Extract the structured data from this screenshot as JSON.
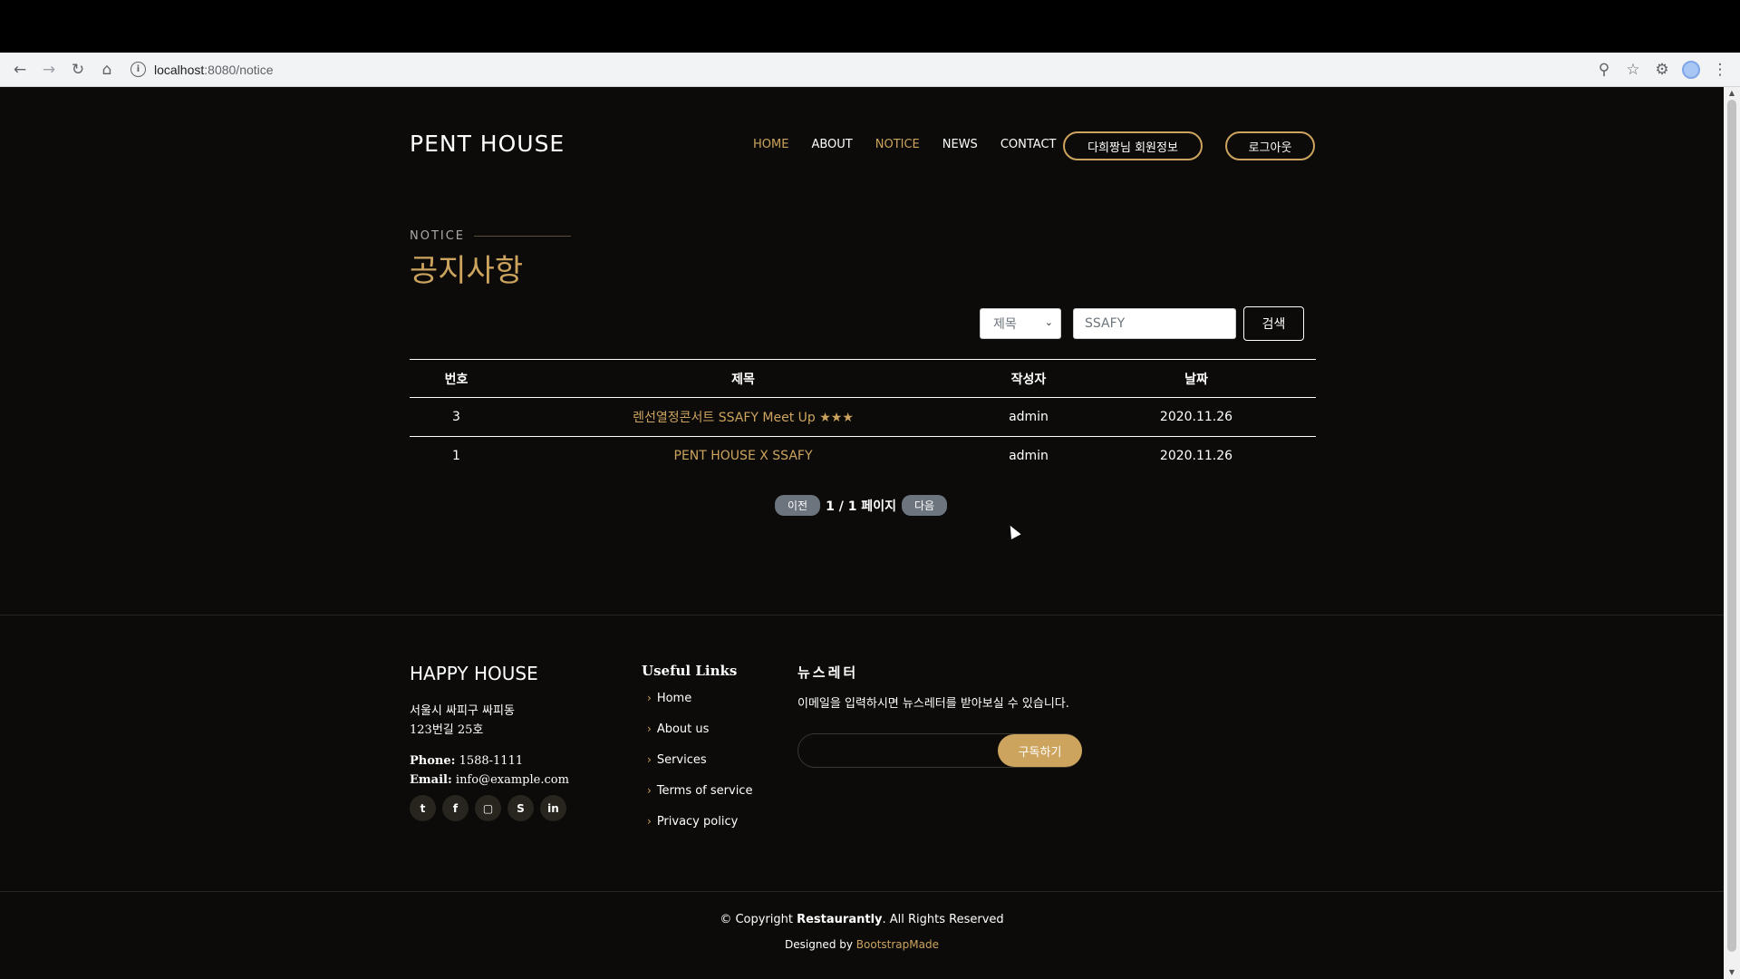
{
  "browser": {
    "url_host": "localhost",
    "url_path": ":8080/notice"
  },
  "header": {
    "logo": "PENT HOUSE",
    "nav": [
      "HOME",
      "ABOUT",
      "NOTICE",
      "NEWS",
      "CONTACT"
    ],
    "active_nav": "NOTICE",
    "member_info_button": "다희짱님 회원정보",
    "logout_button": "로그아웃"
  },
  "section": {
    "label": "NOTICE",
    "title": "공지사항"
  },
  "search": {
    "select_value": "제목",
    "input_value": "SSAFY",
    "button_label": "검색"
  },
  "table": {
    "headers": [
      "번호",
      "제목",
      "작성자",
      "날짜"
    ],
    "rows": [
      {
        "no": "3",
        "title": "렌선열정콘서트 SSAFY Meet Up ★★★",
        "author": "admin",
        "date": "2020.11.26"
      },
      {
        "no": "1",
        "title": "PENT HOUSE X SSAFY",
        "author": "admin",
        "date": "2020.11.26"
      }
    ]
  },
  "pagination": {
    "prev": "이전",
    "info": "1 / 1 페이지",
    "next": "다음"
  },
  "footer": {
    "logo": "HAPPY HOUSE",
    "address_line1": "서울시 싸피구 싸피동",
    "address_line2": "123번길 25호",
    "phone_label": "Phone:",
    "phone": "1588-1111",
    "email_label": "Email:",
    "email": "info@example.com",
    "socials": [
      "twitter-icon",
      "facebook-icon",
      "instagram-icon",
      "skype-icon",
      "linkedin-icon"
    ],
    "links_title": "Useful Links",
    "links": [
      "Home",
      "About us",
      "Services",
      "Terms of service",
      "Privacy policy"
    ],
    "newsletter_title": "뉴스레터",
    "newsletter_text": "이메일을 입력하시면 뉴스레터를 받아보실 수 있습니다.",
    "subscribe_button": "구독하기"
  },
  "copyright": {
    "prefix": "© Copyright",
    "brand": "Restaurantly",
    "suffix": ". All Rights Reserved",
    "designed_by": "Designed by",
    "designer": "BootstrapMade"
  },
  "colors": {
    "accent": "#cda45e",
    "background": "#0c0b09"
  }
}
